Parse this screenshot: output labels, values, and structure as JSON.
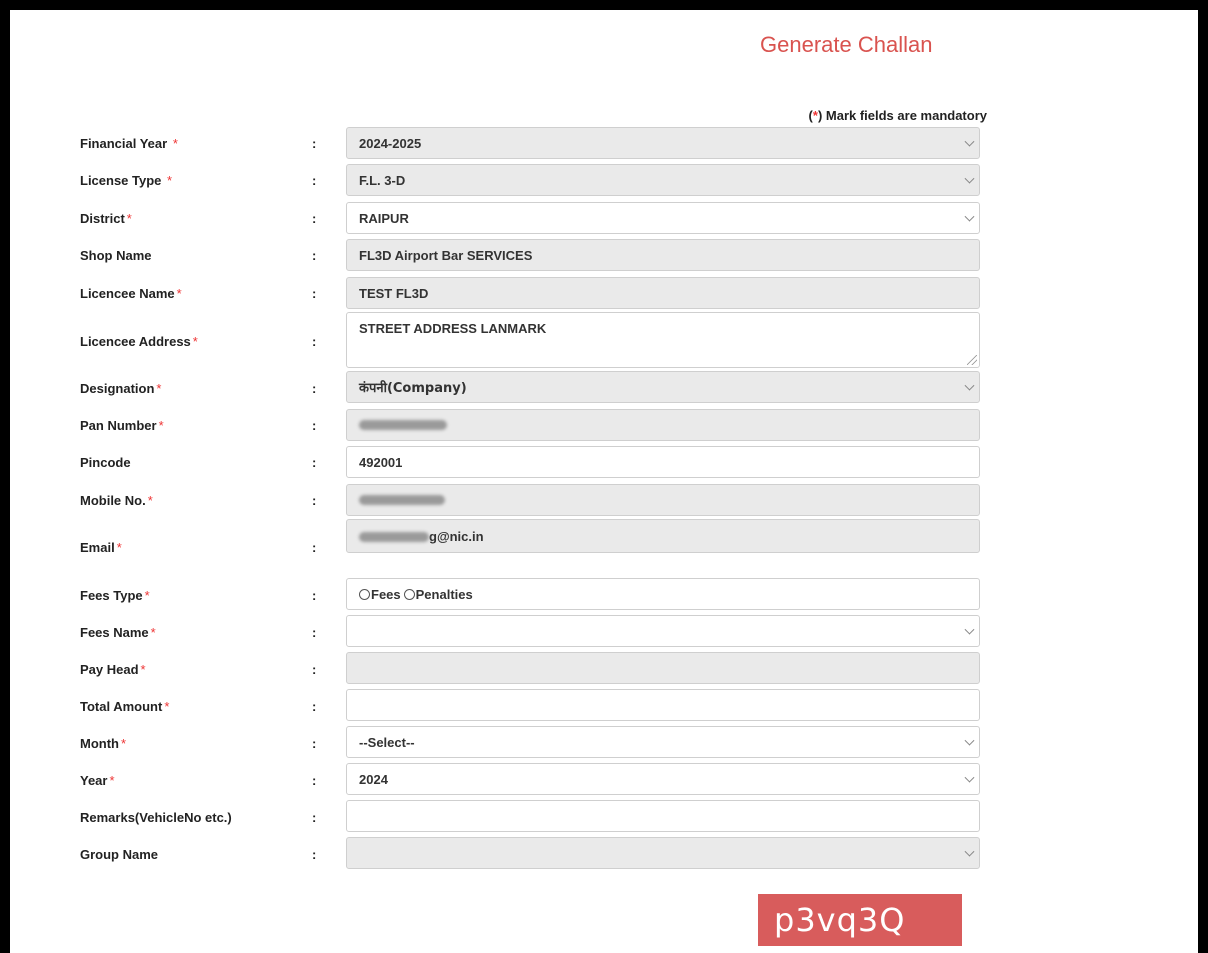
{
  "page": {
    "title": "Generate Challan",
    "mandatory_prefix": "(",
    "mandatory_star": "*",
    "mandatory_text": ") Mark fields are mandatory",
    "colon": ":",
    "required_mark": "*"
  },
  "form": {
    "financial_year": {
      "label": "Financial Year",
      "value": "2024-2025"
    },
    "license_type": {
      "label": "License Type",
      "value": "F.L. 3-D"
    },
    "district": {
      "label": "District",
      "value": "RAIPUR"
    },
    "shop_name": {
      "label": "Shop Name",
      "value": "FL3D Airport Bar SERVICES"
    },
    "licencee_name": {
      "label": "Licencee Name",
      "value": "TEST FL3D"
    },
    "licencee_address": {
      "label": "Licencee Address",
      "value": "STREET ADDRESS LANMARK"
    },
    "designation": {
      "label": "Designation",
      "value": "कंपनी(Company)"
    },
    "pan_number": {
      "label": "Pan Number",
      "value": ""
    },
    "pincode": {
      "label": "Pincode",
      "value": "492001"
    },
    "mobile_no": {
      "label": "Mobile No.",
      "value": ""
    },
    "email": {
      "label": "Email",
      "value_visible": "g@nic.in"
    },
    "fees_type": {
      "label": "Fees Type",
      "options": [
        "Fees",
        "Penalties"
      ]
    },
    "fees_name": {
      "label": "Fees Name",
      "value": ""
    },
    "pay_head": {
      "label": "Pay Head",
      "value": ""
    },
    "total_amount": {
      "label": "Total Amount",
      "value": ""
    },
    "month": {
      "label": "Month",
      "value": "--Select--"
    },
    "year": {
      "label": "Year",
      "value": "2024"
    },
    "remarks": {
      "label": "Remarks(VehicleNo etc.)",
      "value": ""
    },
    "group_name": {
      "label": "Group Name",
      "value": ""
    }
  },
  "captcha": {
    "text": "p3vq3Q"
  },
  "colors": {
    "accent": "#d9534f",
    "required": "#ee3333",
    "readonly_bg": "#eaeaea",
    "captcha_bg": "#d85c5c"
  }
}
